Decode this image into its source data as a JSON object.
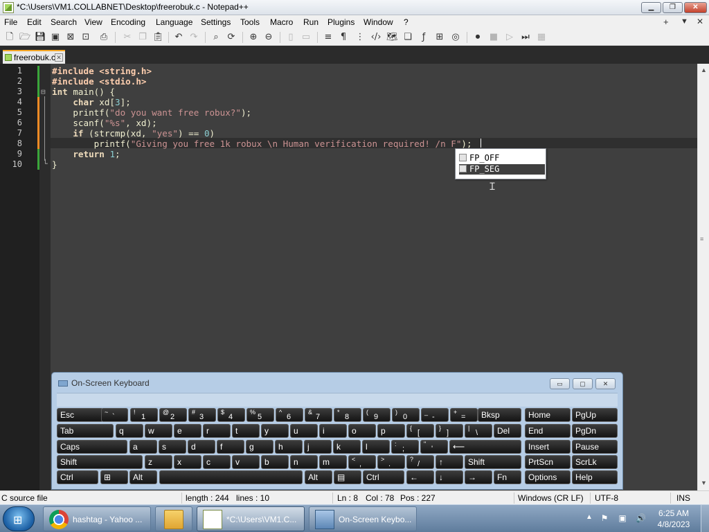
{
  "window": {
    "title": "*C:\\Users\\VM1.COLLABNET\\Desktop\\freerobuk.c - Notepad++",
    "min_glyph": "▁",
    "max_glyph": "❐",
    "close_glyph": "✕"
  },
  "menu": {
    "items": [
      "File",
      "Edit",
      "Search",
      "View",
      "Encoding",
      "Language",
      "Settings",
      "Tools",
      "Macro",
      "Run",
      "Plugins",
      "Window",
      "?"
    ],
    "right": [
      "+",
      "▼",
      "✕"
    ]
  },
  "toolbar": {
    "icons": [
      "new-icon",
      "open-icon",
      "save-icon",
      "save-all-icon",
      "close-icon",
      "close-all-icon",
      "print-icon",
      "cut-icon",
      "copy-icon",
      "paste-icon",
      "undo-icon",
      "redo-icon",
      "find-icon",
      "replace-icon",
      "zoom-in-icon",
      "zoom-out-icon",
      "sync-v-icon",
      "sync-h-icon",
      "word-wrap-icon",
      "show-all-chars-icon",
      "indent-guide-icon",
      "xml-icon",
      "doc-map-icon",
      "doc-list-icon",
      "function-list-icon",
      "folder-workspace-icon",
      "monitoring-icon",
      "record-macro-icon",
      "stop-macro-icon",
      "play-macro-icon",
      "run-macro-multiple-icon",
      "save-macro-icon"
    ]
  },
  "tab": {
    "label": "freerobuk.c",
    "close_glyph": "✕"
  },
  "editor": {
    "line_numbers": [
      "1",
      "2",
      "3",
      "4",
      "5",
      "6",
      "7",
      "8",
      "9",
      "10"
    ],
    "lines": [
      [
        {
          "t": "#include <string.h>",
          "c": "pp"
        }
      ],
      [
        {
          "t": "#include <stdio.h>",
          "c": "pp"
        }
      ],
      [
        {
          "t": "int",
          "c": "kw"
        },
        {
          "t": " main() {",
          "c": "op"
        }
      ],
      [
        {
          "t": "    ",
          "c": ""
        },
        {
          "t": "char",
          "c": "kw"
        },
        {
          "t": " xd[",
          "c": "op"
        },
        {
          "t": "3",
          "c": "num"
        },
        {
          "t": "];",
          "c": "op"
        }
      ],
      [
        {
          "t": "    printf(",
          "c": "op"
        },
        {
          "t": "\"do you want free robux?\"",
          "c": "str"
        },
        {
          "t": ");",
          "c": "op"
        }
      ],
      [
        {
          "t": "    scanf(",
          "c": "op"
        },
        {
          "t": "\"%s\"",
          "c": "str"
        },
        {
          "t": ", xd);",
          "c": "op"
        }
      ],
      [
        {
          "t": "    ",
          "c": ""
        },
        {
          "t": "if",
          "c": "kw"
        },
        {
          "t": " (strcmp(xd, ",
          "c": "op"
        },
        {
          "t": "\"yes\"",
          "c": "str"
        },
        {
          "t": ") == ",
          "c": "op"
        },
        {
          "t": "0",
          "c": "num"
        },
        {
          "t": ")",
          "c": "op"
        }
      ],
      [
        {
          "t": "        printf(",
          "c": "op"
        },
        {
          "t": "\"Giving you free 1k robux \\n Human verification required! /n F\"",
          "c": "str"
        },
        {
          "t": ");",
          "c": "op"
        }
      ],
      [
        {
          "t": "    ",
          "c": ""
        },
        {
          "t": "return",
          "c": "kw"
        },
        {
          "t": " ",
          "c": "op"
        },
        {
          "t": "1",
          "c": "num"
        },
        {
          "t": ";",
          "c": "op"
        }
      ],
      [
        {
          "t": "}",
          "c": "op"
        }
      ]
    ],
    "fold_open": "⊟",
    "fold_end": "└"
  },
  "autocomplete": {
    "items": [
      "FP_OFF",
      "FP_SEG"
    ],
    "selected_index": 1
  },
  "osk": {
    "title": "On-Screen Keyboard",
    "min_glyph": "▭",
    "max_glyph": "▢",
    "close_glyph": "✕",
    "rows": [
      [
        [
          "Esc"
        ],
        [
          "~",
          "`"
        ],
        [
          "!",
          "1"
        ],
        [
          "@",
          "2"
        ],
        [
          "#",
          "3"
        ],
        [
          "$",
          "4"
        ],
        [
          "%",
          "5"
        ],
        [
          "^",
          "6"
        ],
        [
          "&",
          "7"
        ],
        [
          "*",
          "8"
        ],
        [
          "(",
          "9"
        ],
        [
          ")",
          "0"
        ],
        [
          "_",
          "-"
        ],
        [
          "+",
          "="
        ],
        [
          "Bksp"
        ],
        [
          "Home"
        ],
        [
          "PgUp"
        ]
      ],
      [
        [
          "Tab"
        ],
        [
          "q"
        ],
        [
          "w"
        ],
        [
          "e"
        ],
        [
          "r"
        ],
        [
          "t"
        ],
        [
          "y"
        ],
        [
          "u"
        ],
        [
          "i"
        ],
        [
          "o"
        ],
        [
          "p"
        ],
        [
          "{",
          "["
        ],
        [
          "}",
          "]"
        ],
        [
          "|",
          "\\"
        ],
        [
          "Del"
        ],
        [
          "End"
        ],
        [
          "PgDn"
        ]
      ],
      [
        [
          "Caps"
        ],
        [
          "a"
        ],
        [
          "s"
        ],
        [
          "d"
        ],
        [
          "f"
        ],
        [
          "g"
        ],
        [
          "h"
        ],
        [
          "j"
        ],
        [
          "k"
        ],
        [
          "l"
        ],
        [
          ":",
          ";"
        ],
        [
          "\"",
          "'"
        ],
        [
          "⟵"
        ],
        [
          "Insert"
        ],
        [
          "Pause"
        ]
      ],
      [
        [
          "Shift"
        ],
        [
          "z"
        ],
        [
          "x"
        ],
        [
          "c"
        ],
        [
          "v"
        ],
        [
          "b"
        ],
        [
          "n"
        ],
        [
          "m"
        ],
        [
          "<",
          ","
        ],
        [
          ">",
          "."
        ],
        [
          "?",
          "/"
        ],
        [
          "↑"
        ],
        [
          "Shift"
        ],
        [
          "PrtScn"
        ],
        [
          "ScrLk"
        ]
      ],
      [
        [
          "Ctrl"
        ],
        [
          "⊞"
        ],
        [
          "Alt"
        ],
        [
          ""
        ],
        [
          "Alt"
        ],
        [
          "▤"
        ],
        [
          "Ctrl"
        ],
        [
          "←"
        ],
        [
          "↓"
        ],
        [
          "→"
        ],
        [
          "Fn"
        ],
        [
          "Options"
        ],
        [
          "Help"
        ]
      ]
    ]
  },
  "status": {
    "file_type": "C source file",
    "length": "length : 244",
    "lines": "lines : 10",
    "ln": "Ln : 8",
    "col": "Col : 78",
    "pos": "Pos : 227",
    "eol": "Windows (CR LF)",
    "encoding": "UTF-8",
    "mode": "INS"
  },
  "taskbar": {
    "items": [
      {
        "label": "hashtag - Yahoo ...",
        "icon": "chrome-icon"
      },
      {
        "label": "",
        "icon": "folder-icon"
      },
      {
        "label": "*C:\\Users\\VM1.C...",
        "icon": "notepadpp-icon"
      },
      {
        "label": "On-Screen Keybo...",
        "icon": "keyboard-icon"
      }
    ],
    "tray_arrow": "▲",
    "tray_icons": [
      "⚑",
      "▣",
      "🔊"
    ],
    "time": "6:25 AM",
    "date": "4/8/2023"
  },
  "colors": {
    "editor_bg": "#3f3f3f",
    "keyword": "#efdcbc",
    "string": "#cc9393",
    "number": "#8cd0d3",
    "tab_accent": "#f5a623"
  }
}
